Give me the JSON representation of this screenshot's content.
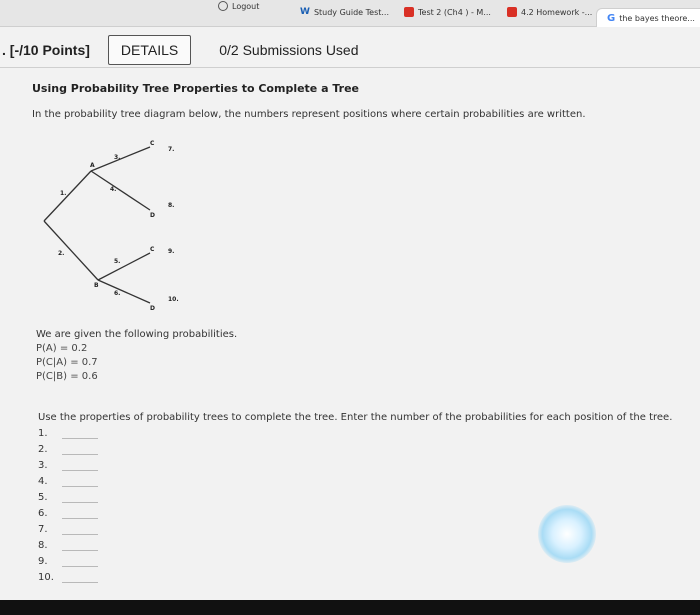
{
  "browser": {
    "tabs": [
      {
        "label": "Logout",
        "icon": "logout-icon"
      },
      {
        "label": "Study Guide Test...",
        "icon": "study-icon"
      },
      {
        "label": "Test 2 (Ch4 ) - M...",
        "icon": "red-doc-icon"
      },
      {
        "label": "4.2 Homework -...",
        "icon": "red-doc-icon"
      },
      {
        "label": "the bayes theore...",
        "icon": "google-icon"
      }
    ]
  },
  "question": {
    "points": ". [-/10 Points]",
    "details_label": "DETAILS",
    "submissions": "0/2 Submissions Used",
    "title": "Using Probability Tree Properties to Complete a Tree",
    "intro": "In the probability tree diagram below, the numbers represent positions where certain probabilities are written."
  },
  "tree": {
    "nodes": {
      "a": "A",
      "b": "B",
      "c_top": "C",
      "d_top": "D",
      "c_bottom": "C",
      "d_bottom": "D"
    },
    "positions": [
      "1.",
      "2.",
      "3.",
      "4.",
      "5.",
      "6.",
      "7.",
      "8.",
      "9.",
      "10."
    ]
  },
  "given": {
    "heading": "We are given the following probabilities.",
    "items": [
      "P(A) = 0.2",
      "P(C|A) = 0.7",
      "P(C|B) = 0.6"
    ]
  },
  "instructions": "Use the properties of probability trees to complete the tree. Enter the number of the probabilities for each position of the tree.",
  "answers": [
    {
      "label": "1.",
      "value": ""
    },
    {
      "label": "2.",
      "value": ""
    },
    {
      "label": "3.",
      "value": ""
    },
    {
      "label": "4.",
      "value": ""
    },
    {
      "label": "5.",
      "value": ""
    },
    {
      "label": "6.",
      "value": ""
    },
    {
      "label": "7.",
      "value": ""
    },
    {
      "label": "8.",
      "value": ""
    },
    {
      "label": "9.",
      "value": ""
    },
    {
      "label": "10.",
      "value": ""
    }
  ]
}
